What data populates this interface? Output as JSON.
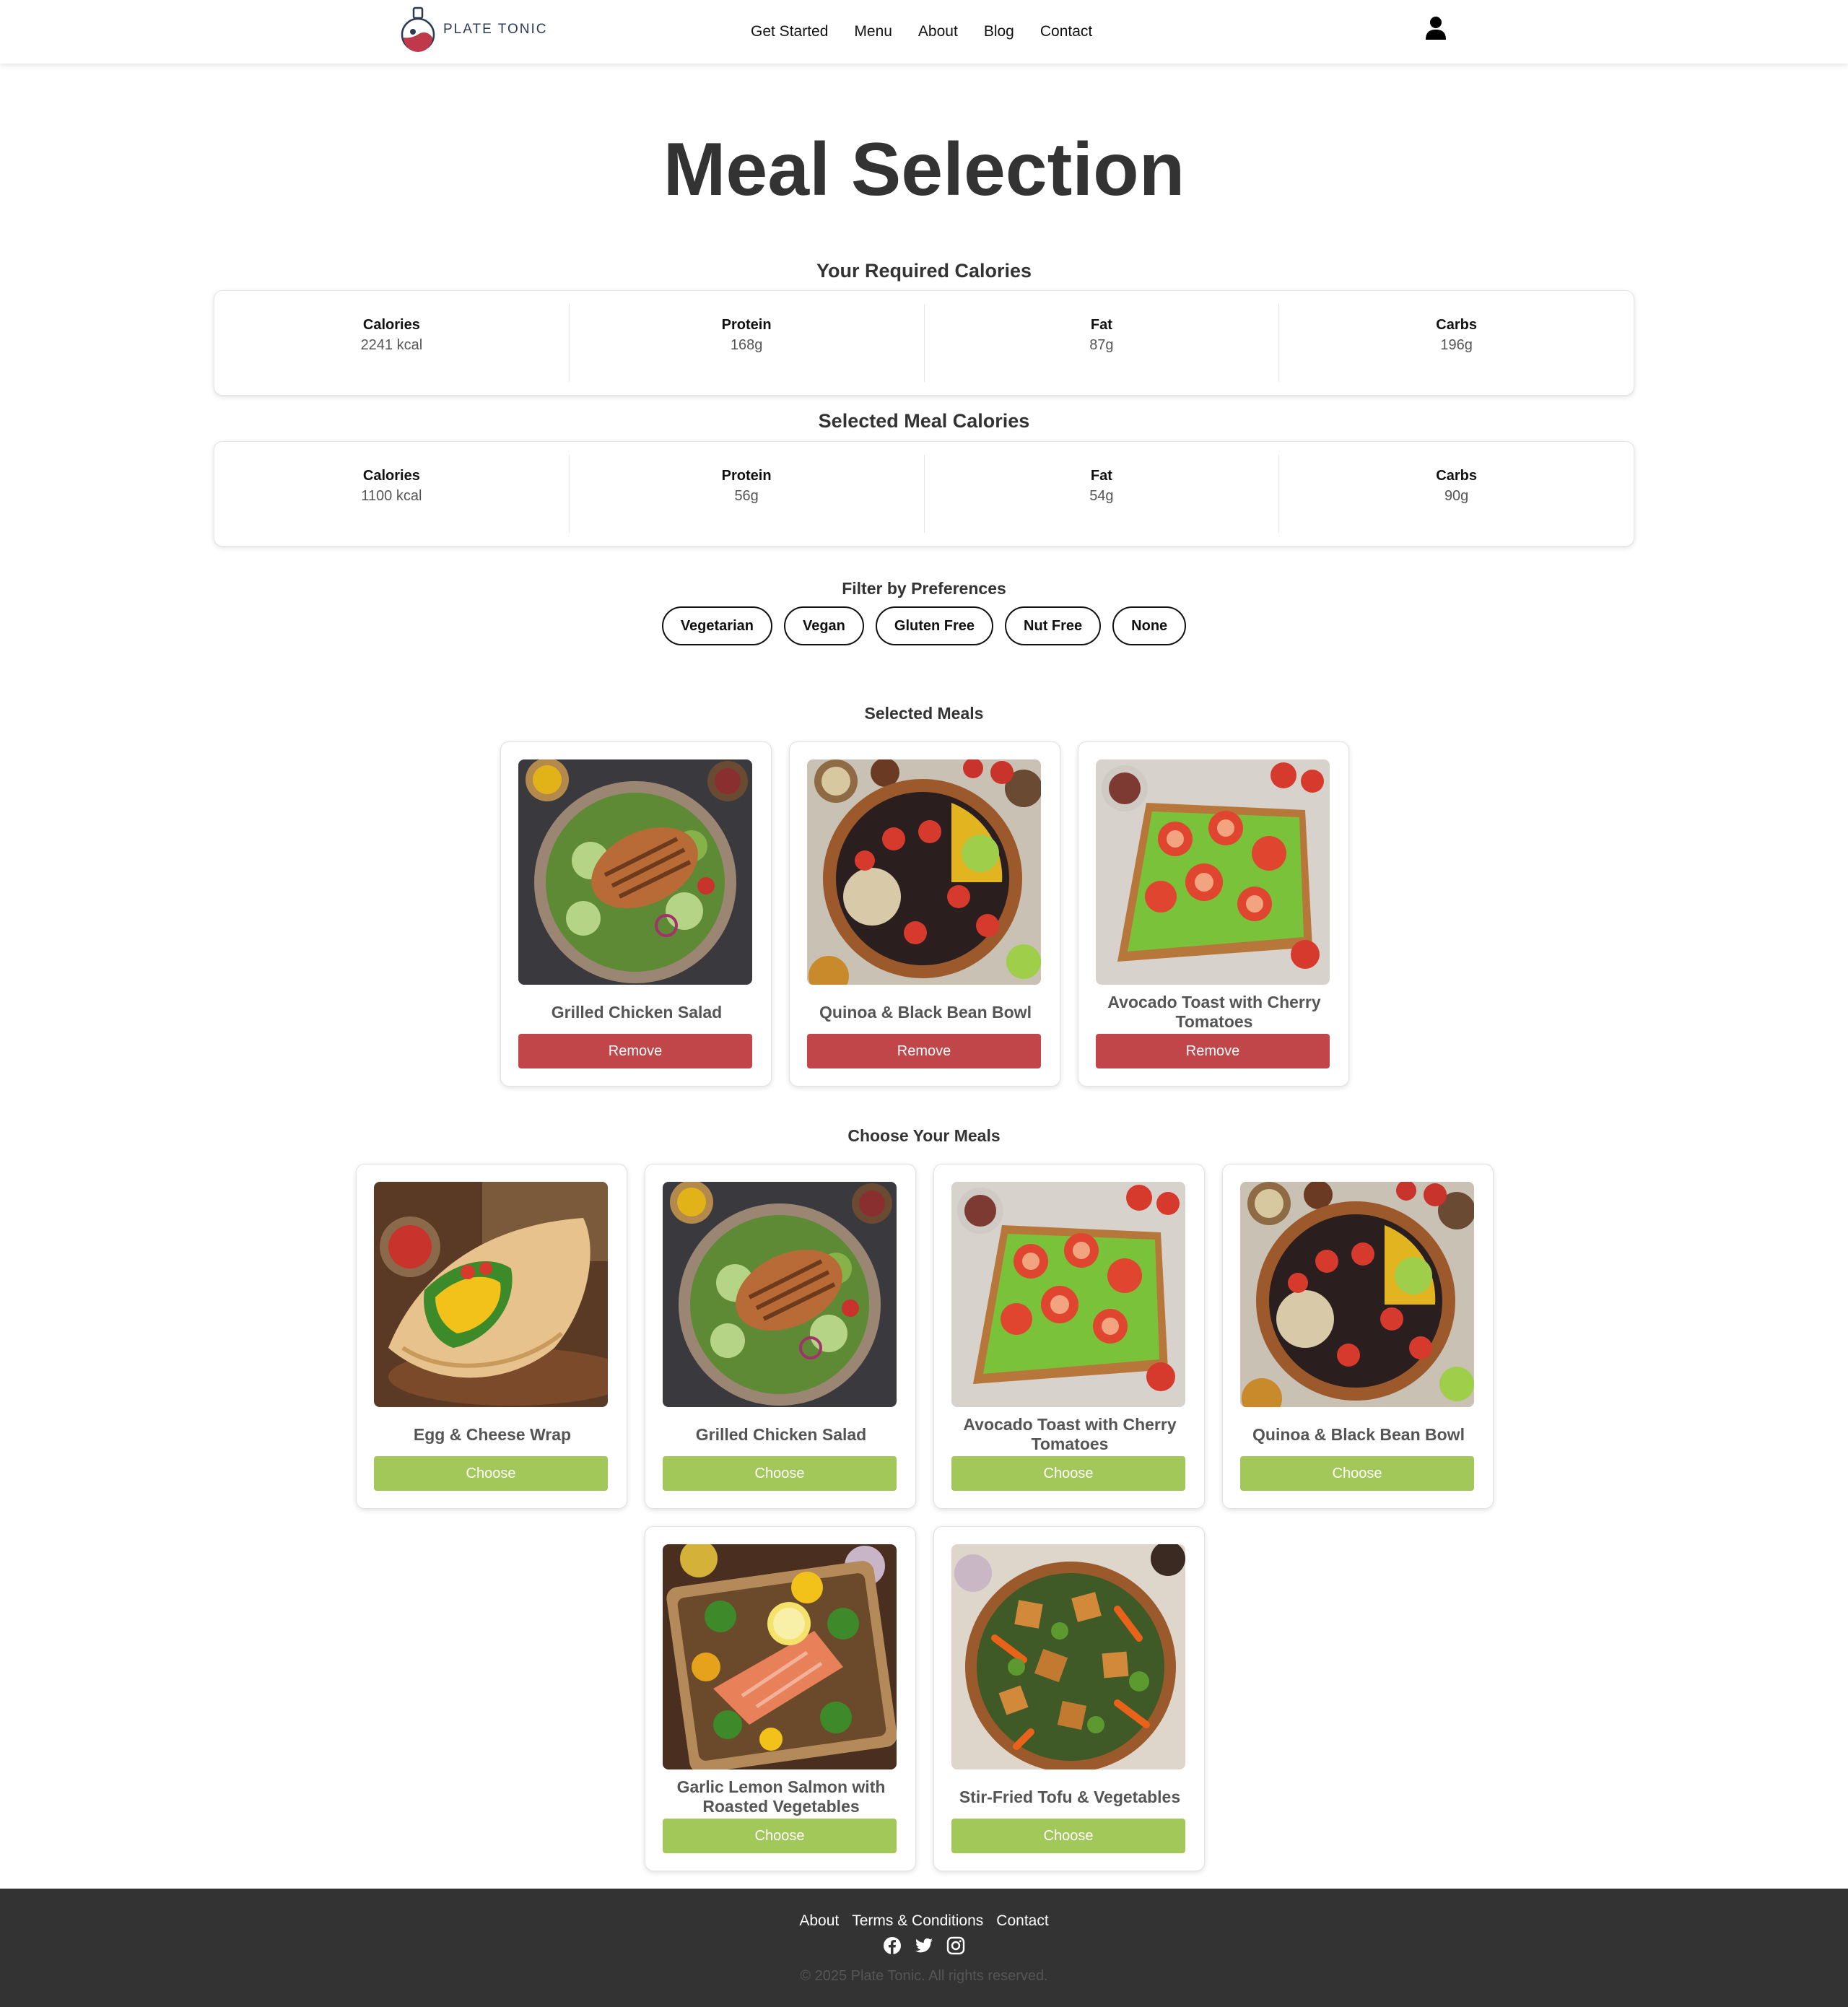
{
  "header": {
    "logo_text": "PLATE TONIC",
    "nav": [
      "Get Started",
      "Menu",
      "About",
      "Blog",
      "Contact"
    ]
  },
  "page_title": "Meal Selection",
  "required": {
    "title": "Your Required Calories",
    "stats": [
      {
        "label": "Calories",
        "value": "2241 kcal"
      },
      {
        "label": "Protein",
        "value": "168g"
      },
      {
        "label": "Fat",
        "value": "87g"
      },
      {
        "label": "Carbs",
        "value": "196g"
      }
    ]
  },
  "selected_totals": {
    "title": "Selected Meal Calories",
    "stats": [
      {
        "label": "Calories",
        "value": "1100 kcal"
      },
      {
        "label": "Protein",
        "value": "56g"
      },
      {
        "label": "Fat",
        "value": "54g"
      },
      {
        "label": "Carbs",
        "value": "90g"
      }
    ]
  },
  "filters": {
    "title": "Filter by Preferences",
    "options": [
      "Vegetarian",
      "Vegan",
      "Gluten Free",
      "Nut Free",
      "None"
    ]
  },
  "selected_meals": {
    "title": "Selected Meals",
    "items": [
      {
        "name": "Grilled Chicken Salad",
        "button": "Remove",
        "image": "chicken-salad"
      },
      {
        "name": "Quinoa & Black Bean Bowl",
        "button": "Remove",
        "image": "quinoa-bowl"
      },
      {
        "name": "Avocado Toast with Cherry Tomatoes",
        "button": "Remove",
        "image": "avocado-toast"
      }
    ]
  },
  "choose_meals": {
    "title": "Choose Your Meals",
    "items": [
      {
        "name": "Egg & Cheese Wrap",
        "button": "Choose",
        "image": "egg-wrap"
      },
      {
        "name": "Grilled Chicken Salad",
        "button": "Choose",
        "image": "chicken-salad"
      },
      {
        "name": "Avocado Toast with Cherry Tomatoes",
        "button": "Choose",
        "image": "avocado-toast"
      },
      {
        "name": "Quinoa & Black Bean Bowl",
        "button": "Choose",
        "image": "quinoa-bowl"
      },
      {
        "name": "Garlic Lemon Salmon with Roasted Vegetables",
        "button": "Choose",
        "image": "salmon"
      },
      {
        "name": "Stir-Fried Tofu & Vegetables",
        "button": "Choose",
        "image": "tofu-stirfry"
      }
    ]
  },
  "footer": {
    "links": [
      "About",
      "Terms & Conditions",
      "Contact"
    ],
    "social": [
      "facebook-icon",
      "twitter-icon",
      "instagram-icon"
    ],
    "copyright": "© 2025 Plate Tonic. All rights reserved."
  },
  "colors": {
    "remove_button": "#c0464a",
    "choose_button": "#a3c85a",
    "footer_bg": "#333333",
    "title_text": "#333333"
  }
}
